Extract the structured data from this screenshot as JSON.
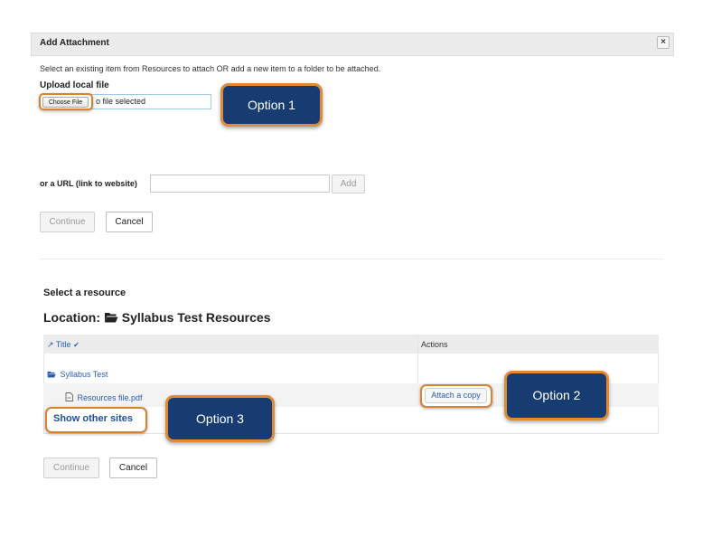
{
  "dialog": {
    "title": "Add Attachment",
    "close_glyph": "×",
    "instructions": "Select an existing item from Resources to attach OR add a new item to a folder to be attached."
  },
  "upload": {
    "label": "Upload local file",
    "choose_button": "Choose File",
    "file_status": "o file selected"
  },
  "url": {
    "label": "or a URL (link to website)",
    "input_value": "",
    "add_button": "Add"
  },
  "top_actions": {
    "continue": "Continue",
    "cancel": "Cancel"
  },
  "resource": {
    "heading": "Select a resource",
    "location_prefix": "Location:",
    "location_name": "Syllabus Test Resources",
    "columns": {
      "title": "Title",
      "actions": "Actions"
    },
    "rows": [
      {
        "label": "Syllabus Test",
        "type": "folder"
      },
      {
        "label": "Resources file.pdf",
        "type": "file",
        "action": "Attach a copy"
      }
    ],
    "show_other_sites": "Show other sites"
  },
  "bottom_actions": {
    "continue": "Continue",
    "cancel": "Cancel"
  },
  "callouts": {
    "option1": "Option 1",
    "option2": "Option 2",
    "option3": "Option 3"
  },
  "colors": {
    "callout_bg": "#163c72",
    "highlight_border": "#d9832e",
    "link": "#2a5db0"
  }
}
